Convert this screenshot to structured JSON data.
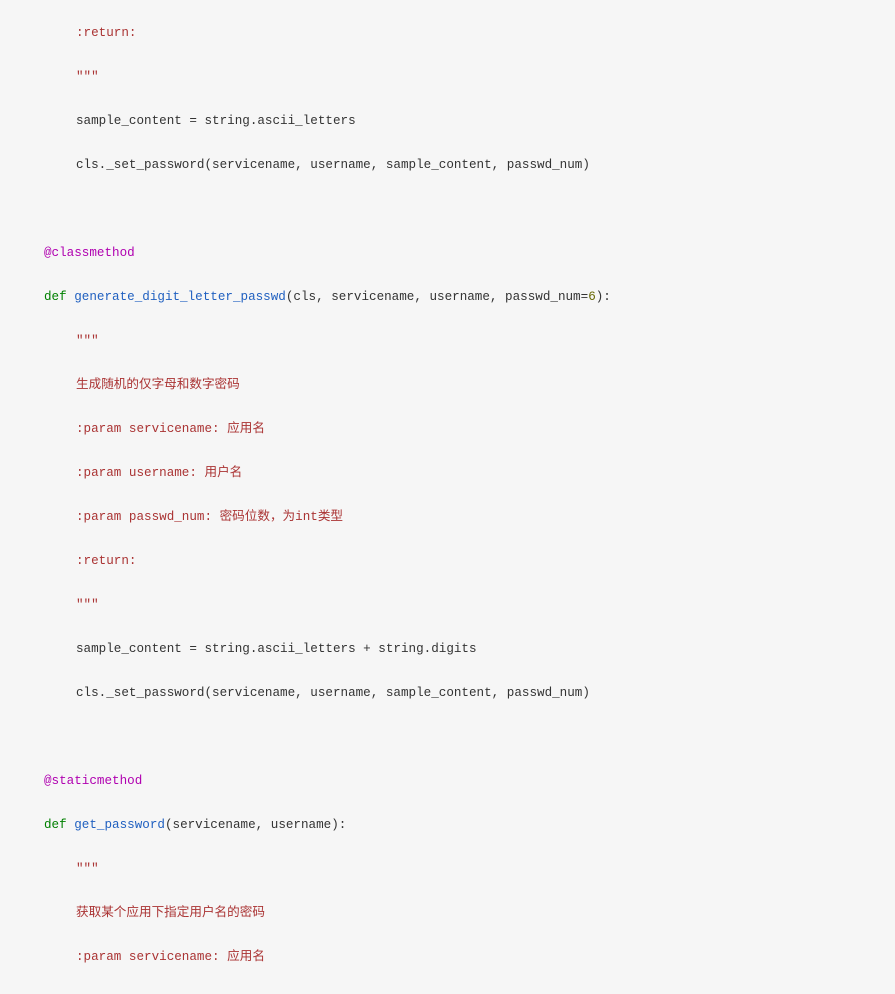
{
  "code": {
    "l1": ":return:",
    "l2": "\"\"\"",
    "l3": "sample_content = string.ascii_letters",
    "l4": "cls._set_password(servicename, username, sample_content, passwd_num)",
    "l5": "@classmethod",
    "l6a": "def",
    "l6b": "generate_digit_letter_passwd",
    "l6c": "(cls, servicename, username, passwd_num=",
    "l6d": "6",
    "l6e": "):",
    "l7": "\"\"\"",
    "l8": "生成随机的仅字母和数字密码",
    "l9": ":param servicename: 应用名",
    "l10": ":param username: 用户名",
    "l11": ":param passwd_num: 密码位数，为int类型",
    "l12": ":return:",
    "l13": "\"\"\"",
    "l14": "sample_content = string.ascii_letters + string.digits",
    "l15": "cls._set_password(servicename, username, sample_content, passwd_num)",
    "l16": "@staticmethod",
    "l17a": "def",
    "l17b": "get_password",
    "l17c": "(servicename, username):",
    "l18": "\"\"\"",
    "l19": "获取某个应用下指定用户名的密码",
    "l20": ":param servicename: 应用名"
  }
}
